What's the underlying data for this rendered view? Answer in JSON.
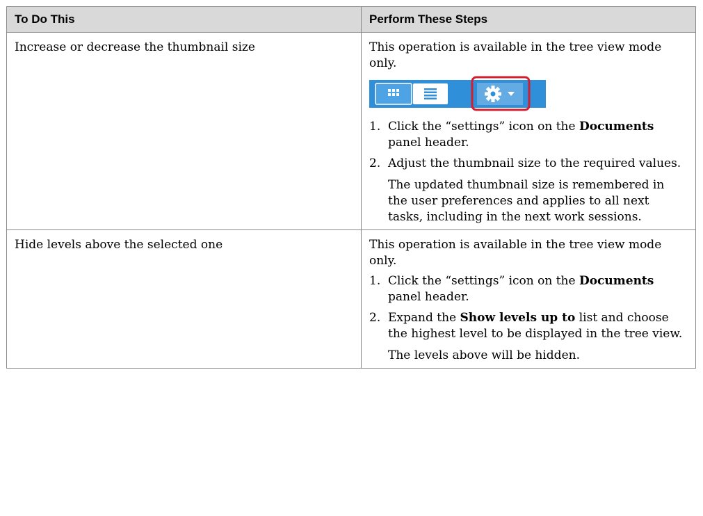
{
  "table": {
    "headers": [
      "To Do This",
      "Perform These Steps"
    ],
    "rows": [
      {
        "action": "Increase or decrease the thumbnail size",
        "intro": "This operation is available in the tree view mode only.",
        "steps": [
          {
            "num": "1.",
            "pre": "Click the “settings” icon on the ",
            "bold": "Documents",
            "post": " panel header."
          },
          {
            "num": "2.",
            "pre": "Adjust the thumbnail size to the required values.",
            "bold": "",
            "post": ""
          }
        ],
        "note": "The updated thumbnail size is remembered in the user preferences and applies to all next tasks, including in the next work sessions."
      },
      {
        "action": "Hide levels above the selected one",
        "intro": "This operation is available in the tree view mode only.",
        "steps": [
          {
            "num": "1.",
            "pre": "Click the “settings” icon on the ",
            "bold": "Documents",
            "post": " panel header."
          },
          {
            "num": "2.",
            "pre": "Expand the ",
            "bold": "Show levels up to",
            "post": " list and choose the highest level to be displayed in the tree view."
          }
        ],
        "note": "The levels above will be hidden."
      }
    ]
  },
  "toolbar_image": {
    "icons": [
      "grid-view-icon",
      "list-view-icon",
      "settings-gear-icon",
      "dropdown-caret-icon"
    ],
    "colors": {
      "bar": "#2f8fd9",
      "highlight": "#d21f2f",
      "panel": "#ffffff"
    }
  }
}
